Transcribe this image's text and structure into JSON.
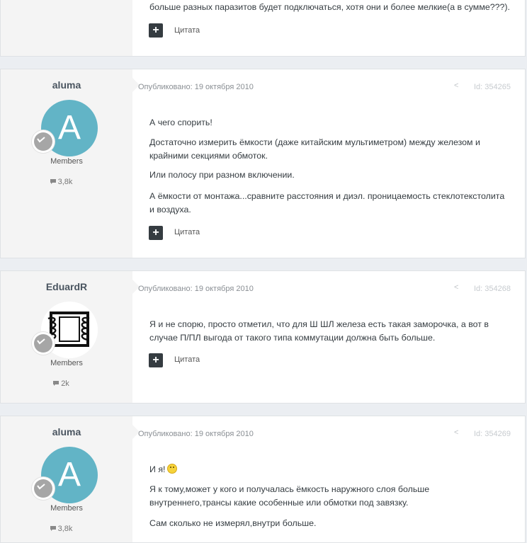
{
  "top_fragment": {
    "text": "больше разных паразитов будет подключаться, хотя они и более мелкие(а в сумме???).",
    "quote_label": "Цитата"
  },
  "posts": [
    {
      "author": "aluma",
      "avatar_letter": "A",
      "group": "Members",
      "post_count": "3,8k",
      "meta": "Опубликовано: 19 октября 2010",
      "post_id": "Id: 354265",
      "paragraphs": [
        "А чего спорить!",
        "Достаточно измерить ёмкости (даже китайским мультиметром) между железом и крайними секциями обмоток.",
        "Или полосу при разном включении.",
        "А ёмкости от монтажа...сравните расстояния и диэл. проницаемость стеклотекстолита и воздуха."
      ],
      "quote_label": "Цитата"
    },
    {
      "author": "EduardR",
      "group": "Members",
      "post_count": "2k",
      "meta": "Опубликовано: 19 октября 2010",
      "post_id": "Id: 354268",
      "paragraphs": [
        "Я и не спорю, просто отметил, что для Ш ШЛ железа есть такая заморочка, а вот в случае П/ПЛ выгода от такого типа коммутации должна быть больше."
      ],
      "quote_label": "Цитата"
    },
    {
      "author": "aluma",
      "avatar_letter": "A",
      "group": "Members",
      "post_count": "3,8k",
      "meta": "Опубликовано: 19 октября 2010",
      "post_id": "Id: 354269",
      "paragraphs": [
        "И я!",
        "Я к тому,может у кого и получалась ёмкость наружного слоя больше внутреннего,трансы какие особенные или обмотки под завязку.",
        "Сам сколько не измерял,внутри больше."
      ]
    }
  ]
}
